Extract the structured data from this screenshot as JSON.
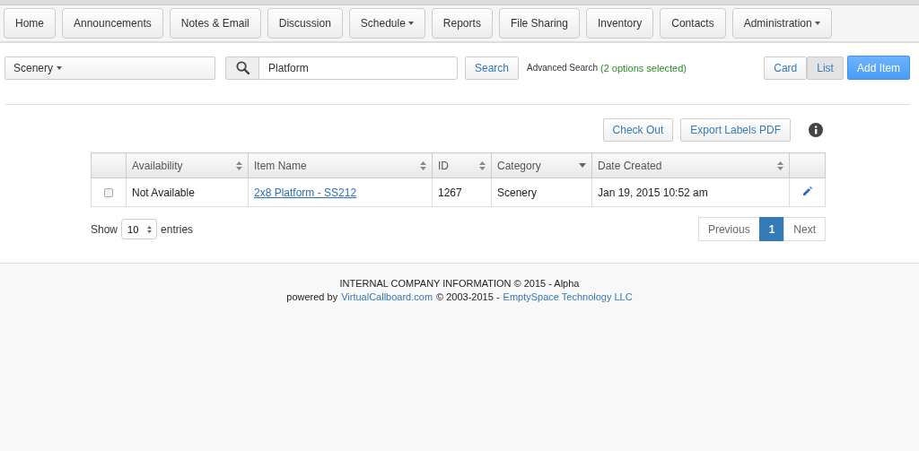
{
  "nav": [
    {
      "label": "Home",
      "dropdown": false
    },
    {
      "label": "Announcements",
      "dropdown": false
    },
    {
      "label": "Notes & Email",
      "dropdown": false
    },
    {
      "label": "Discussion",
      "dropdown": false
    },
    {
      "label": "Schedule",
      "dropdown": true
    },
    {
      "label": "Reports",
      "dropdown": false
    },
    {
      "label": "File Sharing",
      "dropdown": false
    },
    {
      "label": "Inventory",
      "dropdown": false
    },
    {
      "label": "Contacts",
      "dropdown": false
    },
    {
      "label": "Administration",
      "dropdown": true
    }
  ],
  "category_select": {
    "value": "Scenery"
  },
  "search": {
    "value": "Platform",
    "button": "Search"
  },
  "advanced_search": {
    "link": "Advanced Search",
    "note": "(2 options selected)"
  },
  "view_toggle": [
    {
      "label": "Card",
      "selected": false
    },
    {
      "label": "List",
      "selected": true
    }
  ],
  "add_button": "Add Item",
  "actions": [
    "Check Out",
    "Export Labels PDF"
  ],
  "table": {
    "columns": [
      {
        "kind": "plain"
      },
      {
        "label": "Availability",
        "kind": "sortable"
      },
      {
        "label": "Item Name",
        "kind": "sortable"
      },
      {
        "label": "ID",
        "kind": "sortable"
      },
      {
        "label": "Category",
        "kind": "sorted"
      },
      {
        "label": "Date Created",
        "kind": "sortable"
      },
      {
        "kind": "plain"
      }
    ],
    "rows": [
      {
        "checked": false,
        "availability": "Not Available",
        "item_name": "2x8 Platform - SS212",
        "id": "1267",
        "category": "Scenery",
        "date_created": "Jan 19, 2015 10:52 am"
      }
    ]
  },
  "length": {
    "before": "Show",
    "value": "10",
    "after": "entries"
  },
  "pagination": {
    "previous": "Previous",
    "pages": [
      {
        "label": "1",
        "selected": true
      }
    ],
    "next": "Next"
  },
  "footer": {
    "line1": "INTERNAL COMPANY INFORMATION © 2015 - Alpha",
    "powered": "powered by",
    "link1": "VirtualCallboard.com",
    "middle": "© 2003-2015 -",
    "link2": "EmptySpace Technology LLC"
  }
}
